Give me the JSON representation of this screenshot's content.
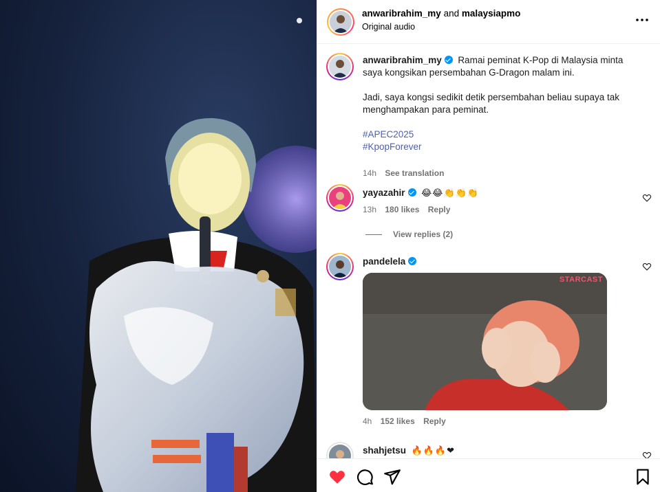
{
  "header": {
    "author": "anwaribrahim_my",
    "joiner": "and",
    "collaborator": "malaysiapmo",
    "audio": "Original audio",
    "more_icon": "more-horizontal-icon"
  },
  "post": {
    "author": "anwaribrahim_my",
    "caption_line1": "Ramai peminat K-Pop di Malaysia minta saya kongsikan persembahan G-Dragon malam ini.",
    "caption_line2": "Jadi, saya kongsi sedikit detik persembahan beliau supaya tak menghampakan para peminat.",
    "hashtags": [
      "#APEC2025",
      "#KpopForever"
    ],
    "time": "14h",
    "translate": "See translation"
  },
  "comments": [
    {
      "user": "yayazahir",
      "text": "😂😂👏👏👏",
      "time": "13h",
      "likes": "180 likes",
      "reply": "Reply",
      "view_replies": "View replies (2)"
    },
    {
      "user": "pandelela",
      "gif_watermark": "STARCAST",
      "time": "4h",
      "likes": "152 likes",
      "reply": "Reply"
    },
    {
      "user": "shahjetsu",
      "text": "🔥🔥🔥❤"
    }
  ],
  "actions": {
    "like_color": "#ff3040",
    "icons": [
      "heart-filled-icon",
      "comment-icon",
      "share-icon",
      "bookmark-icon"
    ]
  }
}
